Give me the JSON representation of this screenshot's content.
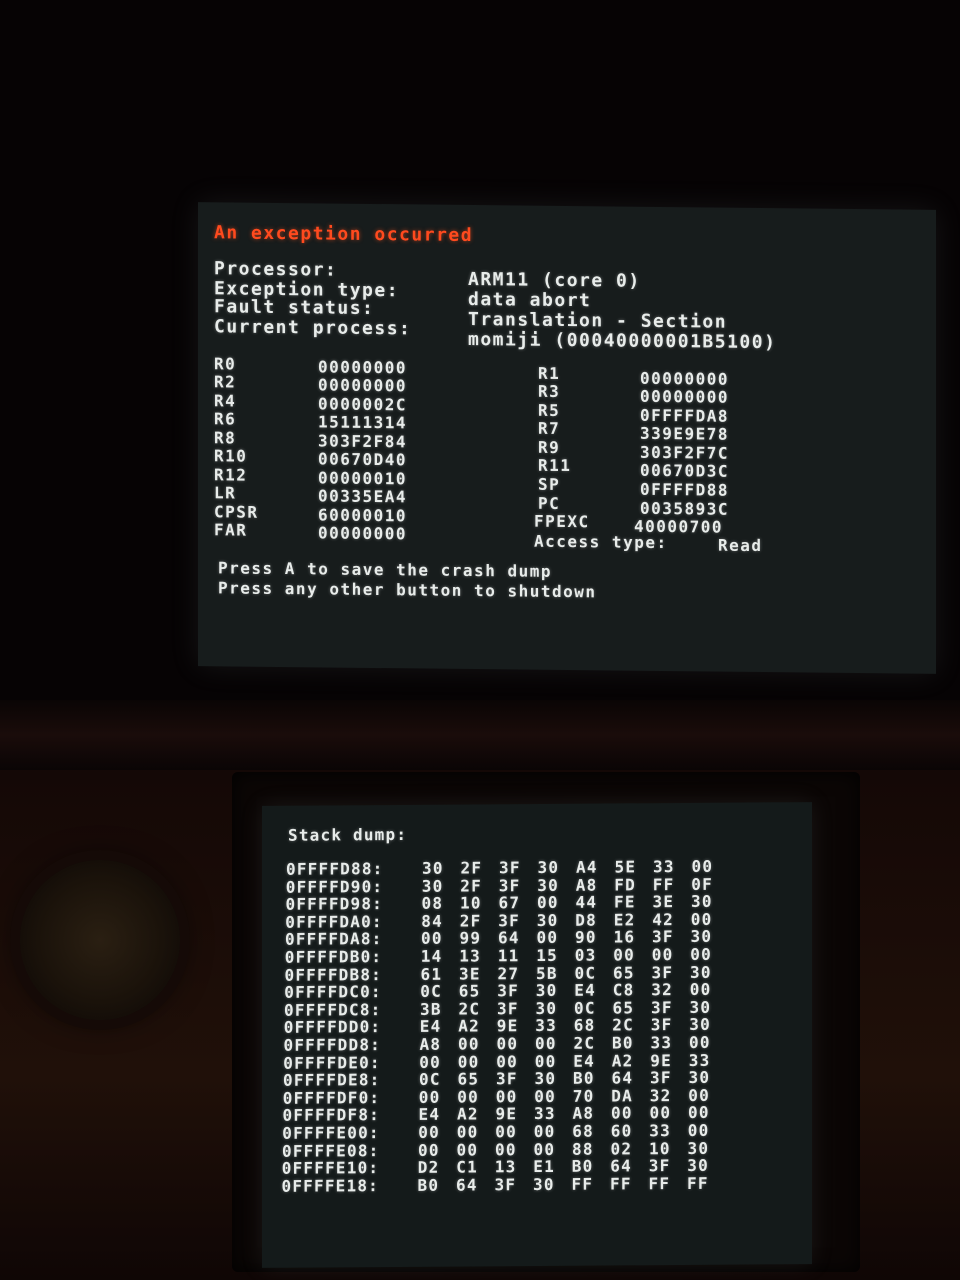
{
  "top_screen": {
    "title": "An exception occurred",
    "info": [
      {
        "label": "Processor:",
        "value": "ARM11 (core 0)"
      },
      {
        "label": "Exception type:",
        "value": "data abort"
      },
      {
        "label": "Fault status:",
        "value": "Translation - Section"
      },
      {
        "label": "Current process:",
        "value": "momiji (00040000001B5100)"
      }
    ],
    "registers_left": [
      {
        "name": "R0",
        "value": "00000000"
      },
      {
        "name": "R2",
        "value": "00000000"
      },
      {
        "name": "R4",
        "value": "0000002C"
      },
      {
        "name": "R6",
        "value": "15111314"
      },
      {
        "name": "R8",
        "value": "303F2F84"
      },
      {
        "name": "R10",
        "value": "00670D40"
      },
      {
        "name": "R12",
        "value": "00000010"
      },
      {
        "name": "LR",
        "value": "00335EA4"
      },
      {
        "name": "CPSR",
        "value": "60000010"
      },
      {
        "name": "FAR",
        "value": "00000000"
      }
    ],
    "registers_right": [
      {
        "name": "R1",
        "value": "00000000"
      },
      {
        "name": "R3",
        "value": "00000000"
      },
      {
        "name": "R5",
        "value": "0FFFFDA8"
      },
      {
        "name": "R7",
        "value": "339E9E78"
      },
      {
        "name": "R9",
        "value": "303F2F7C"
      },
      {
        "name": "R11",
        "value": "00670D3C"
      },
      {
        "name": "SP",
        "value": "0FFFFD88"
      },
      {
        "name": "PC",
        "value": "0035893C"
      },
      {
        "name": "FPEXC",
        "value": "40000700"
      }
    ],
    "access_type_label": "Access type:",
    "access_type_value": "Read",
    "prompt_save": "Press A to save the crash dump",
    "prompt_shutdown": "Press any other button to shutdown"
  },
  "bottom_screen": {
    "title": "Stack dump:",
    "rows": [
      {
        "addr": "0FFFFD88:",
        "bytes": "30 2F 3F 30 A4 5E 33 00"
      },
      {
        "addr": "0FFFFD90:",
        "bytes": "30 2F 3F 30 A8 FD FF 0F"
      },
      {
        "addr": "0FFFFD98:",
        "bytes": "08 10 67 00 44 FE 3E 30"
      },
      {
        "addr": "0FFFFDA0:",
        "bytes": "84 2F 3F 30 D8 E2 42 00"
      },
      {
        "addr": "0FFFFDA8:",
        "bytes": "00 99 64 00 90 16 3F 30"
      },
      {
        "addr": "0FFFFDB0:",
        "bytes": "14 13 11 15 03 00 00 00"
      },
      {
        "addr": "0FFFFDB8:",
        "bytes": "61 3E 27 5B 0C 65 3F 30"
      },
      {
        "addr": "0FFFFDC0:",
        "bytes": "0C 65 3F 30 E4 C8 32 00"
      },
      {
        "addr": "0FFFFDC8:",
        "bytes": "3B 2C 3F 30 0C 65 3F 30"
      },
      {
        "addr": "0FFFFDD0:",
        "bytes": "E4 A2 9E 33 68 2C 3F 30"
      },
      {
        "addr": "0FFFFDD8:",
        "bytes": "A8 00 00 00 2C B0 33 00"
      },
      {
        "addr": "0FFFFDE0:",
        "bytes": "00 00 00 00 E4 A2 9E 33"
      },
      {
        "addr": "0FFFFDE8:",
        "bytes": "0C 65 3F 30 B0 64 3F 30"
      },
      {
        "addr": "0FFFFDF0:",
        "bytes": "00 00 00 00 70 DA 32 00"
      },
      {
        "addr": "0FFFFDF8:",
        "bytes": "E4 A2 9E 33 A8 00 00 00"
      },
      {
        "addr": "0FFFFE00:",
        "bytes": "00 00 00 00 68 60 33 00"
      },
      {
        "addr": "0FFFFE08:",
        "bytes": "00 00 00 00 88 02 10 30"
      },
      {
        "addr": "0FFFFE10:",
        "bytes": "D2 C1 13 E1 B0 64 3F 30"
      },
      {
        "addr": "0FFFFE18:",
        "bytes": "B0 64 3F 30 FF FF FF FF"
      }
    ]
  }
}
